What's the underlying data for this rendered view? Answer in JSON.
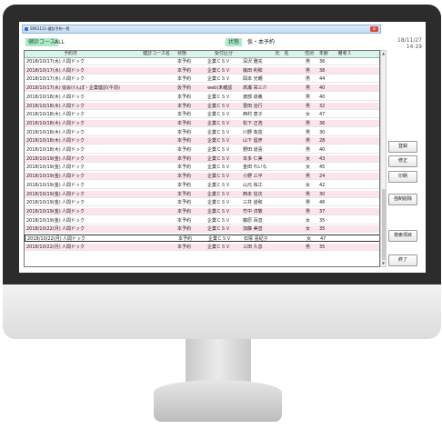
{
  "window": {
    "title": "SRK1111-健診予約一覧",
    "close_label": "x"
  },
  "datetime": {
    "date": "18/11/27",
    "time": "14:19"
  },
  "filter": {
    "course_label": "健診コース",
    "course_value": "ALL",
    "status_label": "状態",
    "status_value": "仮・本予約"
  },
  "columns": {
    "date": "予約日",
    "course": "健診コース名",
    "status": "状態",
    "type": "受付区分",
    "name": "氏　名",
    "sex": "性別",
    "age": "年齢",
    "note": "備考３"
  },
  "rows": [
    {
      "date": "2018/10/17(水)",
      "course": "人間ドック",
      "status": "本予約",
      "type": "企業ＣＳＶ",
      "name": "深沢 雅充",
      "sex": "男",
      "age": "36"
    },
    {
      "date": "2018/10/17(水)",
      "course": "人間ドック",
      "status": "本予約",
      "type": "企業ＣＳＶ",
      "name": "篠田 利和",
      "sex": "男",
      "age": "38"
    },
    {
      "date": "2018/10/17(水)",
      "course": "人間ドック",
      "status": "本予約",
      "type": "企業ＣＳＶ",
      "name": "岡本 光親",
      "sex": "男",
      "age": "44"
    },
    {
      "date": "2018/10/17(水)",
      "course": "協会けんぽ・企業健診(午前)",
      "status": "仮予約",
      "type": "web(未確認",
      "name": "高瀬 栄三介",
      "sex": "男",
      "age": "40"
    },
    {
      "date": "2018/10/18(木)",
      "course": "人間ドック",
      "status": "本予約",
      "type": "企業ＣＳＶ",
      "name": "渡部 道義",
      "sex": "男",
      "age": "40"
    },
    {
      "date": "2018/10/18(木)",
      "course": "人間ドック",
      "status": "本予約",
      "type": "企業ＣＳＶ",
      "name": "豊田 治行",
      "sex": "男",
      "age": "32"
    },
    {
      "date": "2018/10/18(木)",
      "course": "人間ドック",
      "status": "本予約",
      "type": "企業ＣＳＶ",
      "name": "西村 恵子",
      "sex": "女",
      "age": "47"
    },
    {
      "date": "2018/10/18(木)",
      "course": "人間ドック",
      "status": "本予約",
      "type": "企業ＣＳＶ",
      "name": "松下 正浩",
      "sex": "男",
      "age": "36"
    },
    {
      "date": "2018/10/18(木)",
      "course": "人間ドック",
      "status": "本予約",
      "type": "企業ＣＳＶ",
      "name": "川野 有造",
      "sex": "男",
      "age": "30"
    },
    {
      "date": "2018/10/18(木)",
      "course": "人間ドック",
      "status": "本予約",
      "type": "企業ＣＳＶ",
      "name": "山下 留彦",
      "sex": "男",
      "age": "28"
    },
    {
      "date": "2018/10/18(木)",
      "course": "人間ドック",
      "status": "本予約",
      "type": "企業ＣＳＶ",
      "name": "野田 道喜",
      "sex": "男",
      "age": "40"
    },
    {
      "date": "2018/10/19(金)",
      "course": "人間ドック",
      "status": "本予約",
      "type": "企業ＣＳＶ",
      "name": "本多 仁美",
      "sex": "女",
      "age": "43"
    },
    {
      "date": "2018/10/19(金)",
      "course": "人間ドック",
      "status": "本予約",
      "type": "企業ＣＳＶ",
      "name": "金田 れいな",
      "sex": "女",
      "age": "45"
    },
    {
      "date": "2018/10/19(金)",
      "course": "人間ドック",
      "status": "本予約",
      "type": "企業ＣＳＶ",
      "name": "小野 三平",
      "sex": "男",
      "age": "24"
    },
    {
      "date": "2018/10/19(金)",
      "course": "人間ドック",
      "status": "本予約",
      "type": "企業ＣＳＶ",
      "name": "山元 祐江",
      "sex": "女",
      "age": "42"
    },
    {
      "date": "2018/10/19(金)",
      "course": "人間ドック",
      "status": "本予約",
      "type": "企業ＣＳＶ",
      "name": "西本 信次",
      "sex": "男",
      "age": "30"
    },
    {
      "date": "2018/10/19(金)",
      "course": "人間ドック",
      "status": "本予約",
      "type": "企業ＣＳＶ",
      "name": "三井 道和",
      "sex": "男",
      "age": "46"
    },
    {
      "date": "2018/10/19(金)",
      "course": "人間ドック",
      "status": "本予約",
      "type": "企業ＣＳＶ",
      "name": "竹中 貞敬",
      "sex": "男",
      "age": "37"
    },
    {
      "date": "2018/10/19(金)",
      "course": "人間ドック",
      "status": "本予約",
      "type": "企業ＣＳＶ",
      "name": "藤原 百音",
      "sex": "女",
      "age": "35"
    },
    {
      "date": "2018/10/22(月)",
      "course": "人間ドック",
      "status": "本予約",
      "type": "企業ＣＳＶ",
      "name": "加藤 美音",
      "sex": "女",
      "age": "35"
    },
    {
      "date": "2018/10/22(月)",
      "course": "人間ドック",
      "status": "本予約",
      "type": "企業ＣＳＶ",
      "name": "石塚 喜紀子",
      "sex": "女",
      "age": "47"
    },
    {
      "date": "2018/10/22(月)",
      "course": "人間ドック",
      "status": "本予約",
      "type": "企業ＣＳＶ",
      "name": "三田 久息",
      "sex": "男",
      "age": "35"
    }
  ],
  "buttons": {
    "register": "登録",
    "modify": "修正",
    "print": "印刷",
    "force_delete": "強制削除",
    "search": "検索項目",
    "exit": "終了"
  },
  "scroll": {
    "up": "▲",
    "down": "▼"
  },
  "colors": {
    "header_bg": "#d7f3ea",
    "filter_label_bg": "#aee8c8",
    "pink_row": "#fbe5ea"
  }
}
